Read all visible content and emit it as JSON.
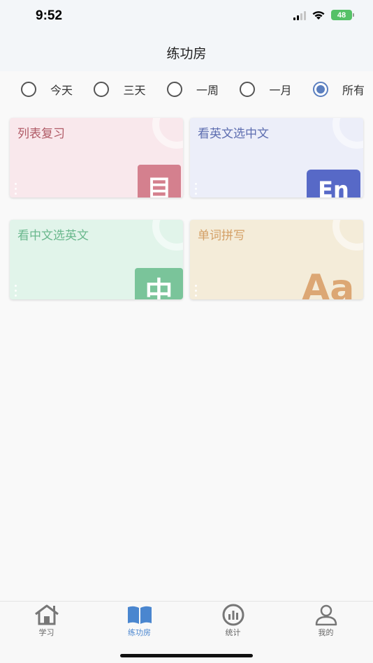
{
  "status_bar": {
    "time": "9:52",
    "battery": "48"
  },
  "header": {
    "title": "练功房"
  },
  "filters": [
    {
      "label": "今天",
      "selected": false
    },
    {
      "label": "三天",
      "selected": false
    },
    {
      "label": "一周",
      "selected": false
    },
    {
      "label": "一月",
      "selected": false
    },
    {
      "label": "所有",
      "selected": true
    }
  ],
  "cards": [
    {
      "title": "列表复习",
      "badge": "目",
      "title_color": "#b05a66",
      "bg": "#f9e8ec",
      "badge_color": "#d4808e",
      "badge_icon": "list-doc-icon"
    },
    {
      "title": "看英文选中文",
      "badge": "En",
      "title_color": "#5d6db0",
      "bg": "#eceef9",
      "badge_color": "#5769c7",
      "badge_icon": "english-icon"
    },
    {
      "title": "看中文选英文",
      "badge": "中",
      "title_color": "#6ab88d",
      "bg": "#e1f4ea",
      "badge_color": "#7ac49a",
      "badge_icon": "chinese-icon"
    },
    {
      "title": "单词拼写",
      "badge": "Aa",
      "title_color": "#d4a066",
      "bg": "#f4ecd9",
      "badge_color": "#dca774",
      "badge_icon": "letters-icon"
    }
  ],
  "tabbar": {
    "items": [
      {
        "label": "学习",
        "icon": "home-icon",
        "active": false
      },
      {
        "label": "练功房",
        "icon": "book-icon",
        "active": true
      },
      {
        "label": "统计",
        "icon": "stats-icon",
        "active": false
      },
      {
        "label": "我的",
        "icon": "profile-icon",
        "active": false
      }
    ],
    "active_color": "#4a86cf"
  }
}
